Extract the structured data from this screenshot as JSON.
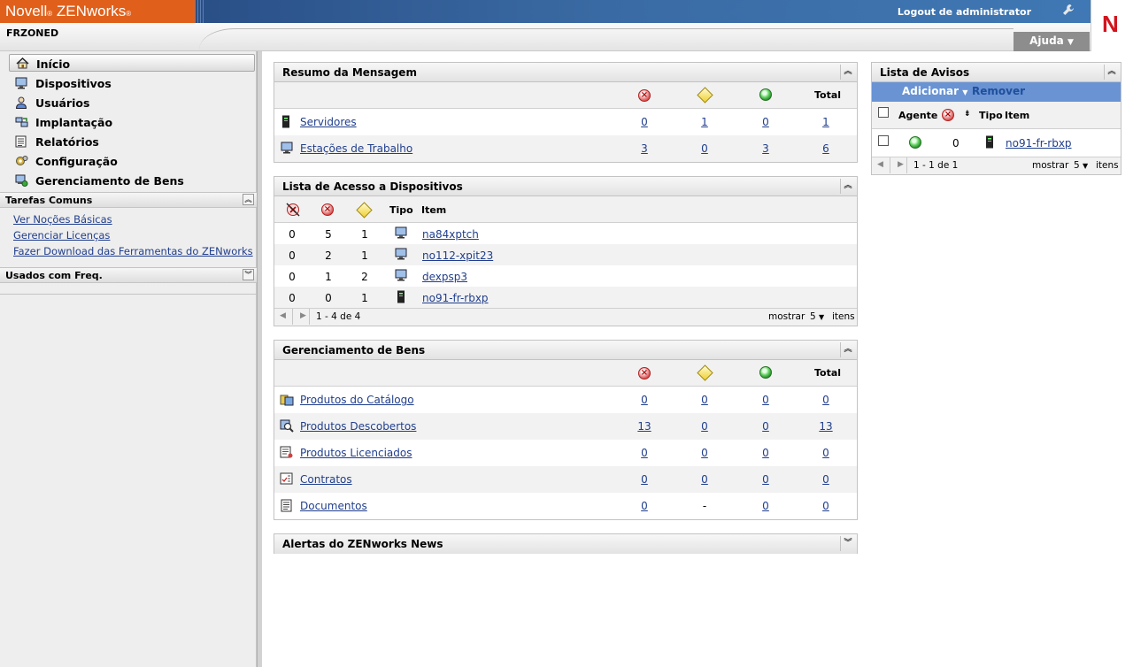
{
  "header": {
    "brand": "Novell",
    "brand_mark": "®",
    "product": "ZENworks",
    "product_mark": "®",
    "logout": "Logout de administrator",
    "zone": "FRZONED",
    "help": "Ajuda",
    "logo_letter": "N"
  },
  "sidebar": {
    "nav": [
      {
        "label": "Início",
        "icon": "home-icon"
      },
      {
        "label": "Dispositivos",
        "icon": "monitor-icon"
      },
      {
        "label": "Usuários",
        "icon": "user-icon"
      },
      {
        "label": "Implantação",
        "icon": "deploy-icon"
      },
      {
        "label": "Relatórios",
        "icon": "report-icon"
      },
      {
        "label": "Configuração",
        "icon": "gear-icon"
      },
      {
        "label": "Gerenciamento de Bens",
        "icon": "asset-icon"
      }
    ],
    "common_tasks_title": "Tarefas Comuns",
    "common_tasks": [
      "Ver Noções Básicas",
      "Gerenciar Licenças",
      "Fazer Download das Ferramentas do ZENworks"
    ],
    "frequent_title": "Usados com Freq."
  },
  "message_summary": {
    "title": "Resumo da Mensagem",
    "total_label": "Total",
    "rows": [
      {
        "label": "Servidores",
        "err": "0",
        "warn": "1",
        "ok": "0",
        "total": "1",
        "icon": "server-icon"
      },
      {
        "label": "Estações de Trabalho",
        "err": "3",
        "warn": "0",
        "ok": "3",
        "total": "6",
        "icon": "workstation-icon"
      }
    ]
  },
  "device_access": {
    "title": "Lista de Acesso a Dispositivos",
    "col_type": "Tipo",
    "col_item": "Item",
    "rows": [
      {
        "a": "0",
        "b": "5",
        "c": "1",
        "icon": "workstation-icon",
        "item": "na84xptch"
      },
      {
        "a": "0",
        "b": "2",
        "c": "1",
        "icon": "workstation-icon",
        "item": "no112-xpit23"
      },
      {
        "a": "0",
        "b": "1",
        "c": "2",
        "icon": "workstation-icon",
        "item": "dexpsp3"
      },
      {
        "a": "0",
        "b": "0",
        "c": "1",
        "icon": "server-icon",
        "item": "no91-fr-rbxp"
      }
    ],
    "pager_range": "1 - 4 de 4",
    "pager_show": "mostrar",
    "pager_count": "5",
    "pager_items": "itens"
  },
  "asset_mgmt": {
    "title": "Gerenciamento de Bens",
    "total_label": "Total",
    "rows": [
      {
        "label": "Produtos do Catálogo",
        "err": "0",
        "warn": "0",
        "ok": "0",
        "total": "0",
        "icon": "catalog-icon"
      },
      {
        "label": "Produtos Descobertos",
        "err": "13",
        "warn": "0",
        "ok": "0",
        "total": "13",
        "icon": "discover-icon"
      },
      {
        "label": "Produtos Licenciados",
        "err": "0",
        "warn": "0",
        "ok": "0",
        "total": "0",
        "icon": "license-icon"
      },
      {
        "label": "Contratos",
        "err": "0",
        "warn": "0",
        "ok": "0",
        "total": "0",
        "icon": "contract-icon"
      },
      {
        "label": "Documentos",
        "err": "0",
        "warn": "-",
        "ok": "0",
        "total": "0",
        "icon": "document-icon"
      }
    ]
  },
  "news": {
    "title": "Alertas do ZENworks News"
  },
  "watch_list": {
    "title": "Lista de Avisos",
    "add": "Adicionar",
    "remove": "Remover",
    "col_agent": "Agente",
    "col_type": "Tipo",
    "col_item": "Item",
    "rows": [
      {
        "count": "0",
        "item": "no91-fr-rbxp",
        "icon": "server-icon"
      }
    ],
    "pager_range": "1 - 1 de 1",
    "pager_show": "mostrar",
    "pager_count": "5",
    "pager_items": "itens"
  }
}
